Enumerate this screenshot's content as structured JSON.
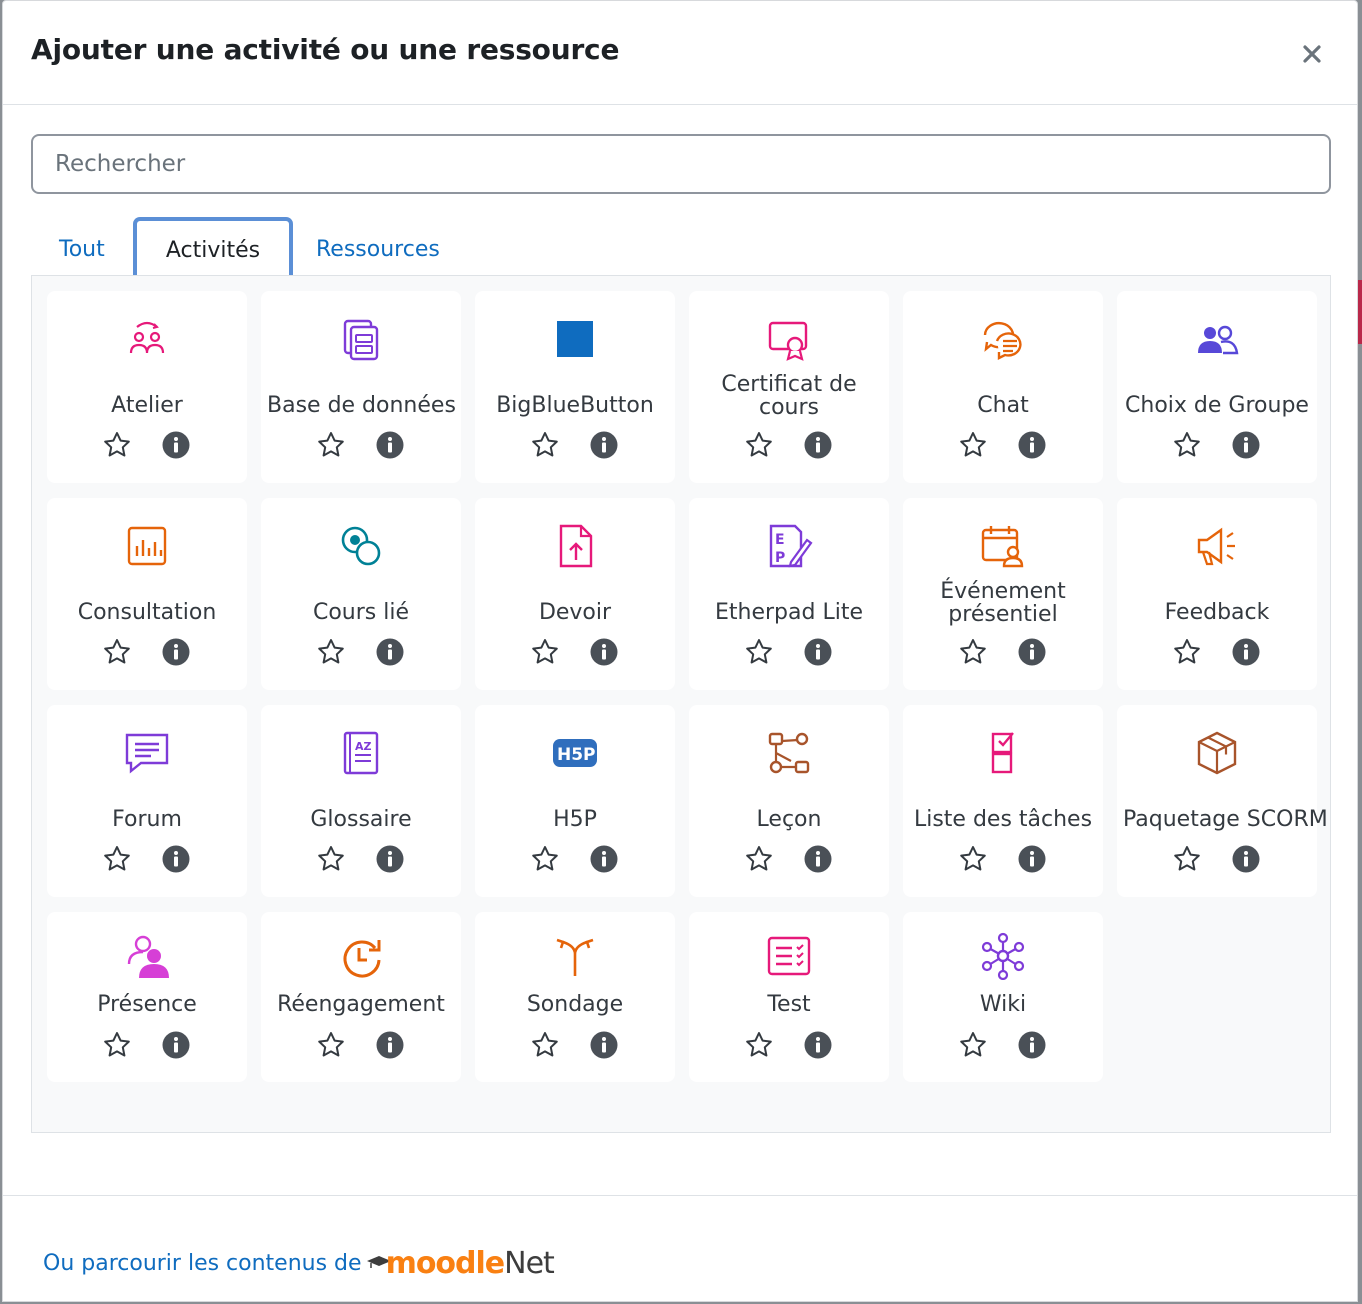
{
  "modal": {
    "title": "Ajouter une activité ou une ressource",
    "close_label": "×"
  },
  "search": {
    "placeholder": "Rechercher",
    "value": ""
  },
  "tabs": [
    {
      "label": "Tout",
      "active": false
    },
    {
      "label": "Activités",
      "active": true
    },
    {
      "label": "Ressources",
      "active": false
    }
  ],
  "activities": [
    {
      "label": "Atelier",
      "icon": "workshop-icon",
      "color": "#e6197a"
    },
    {
      "label": "Base de données",
      "icon": "database-icon",
      "color": "#7e3bd8"
    },
    {
      "label": "BigBlueButton",
      "icon": "bigbluebutton-icon",
      "color": "#0f6cbf"
    },
    {
      "label": "Certificat de cours",
      "icon": "certificate-icon",
      "color": "#e6197a"
    },
    {
      "label": "Chat",
      "icon": "chat-icon",
      "color": "#e5640a"
    },
    {
      "label": "Choix de Groupe",
      "icon": "group-choice-icon",
      "color": "#5748d8"
    },
    {
      "label": "Consultation",
      "icon": "consultation-icon",
      "color": "#e5640a"
    },
    {
      "label": "Cours lié",
      "icon": "linked-course-icon",
      "color": "#008196"
    },
    {
      "label": "Devoir",
      "icon": "assignment-icon",
      "color": "#e6197a"
    },
    {
      "label": "Etherpad Lite",
      "icon": "etherpad-icon",
      "color": "#7e3bd8"
    },
    {
      "label": "Événement présentiel",
      "icon": "face-to-face-icon",
      "color": "#e5640a"
    },
    {
      "label": "Feedback",
      "icon": "feedback-icon",
      "color": "#e5640a"
    },
    {
      "label": "Forum",
      "icon": "forum-icon",
      "color": "#7e3bd8"
    },
    {
      "label": "Glossaire",
      "icon": "glossary-icon",
      "color": "#7e3bd8"
    },
    {
      "label": "H5P",
      "icon": "h5p-icon",
      "color": "#2f6ebd"
    },
    {
      "label": "Leçon",
      "icon": "lesson-icon",
      "color": "#a8542b"
    },
    {
      "label": "Liste des tâches",
      "icon": "checklist-icon",
      "color": "#e6197a"
    },
    {
      "label": "Paquetage SCORM",
      "icon": "scorm-icon",
      "color": "#a8542b"
    },
    {
      "label": "Présence",
      "icon": "attendance-icon",
      "color": "#d63fd6"
    },
    {
      "label": "Réengagement",
      "icon": "reengagement-icon",
      "color": "#e5640a"
    },
    {
      "label": "Sondage",
      "icon": "survey-icon",
      "color": "#e5640a"
    },
    {
      "label": "Test",
      "icon": "quiz-icon",
      "color": "#e6197a"
    },
    {
      "label": "Wiki",
      "icon": "wiki-icon",
      "color": "#7e3bd8"
    }
  ],
  "footer": {
    "link_text": "Ou parcourir les contenus de",
    "logo_part1": "moodle",
    "logo_part2": "Net"
  }
}
